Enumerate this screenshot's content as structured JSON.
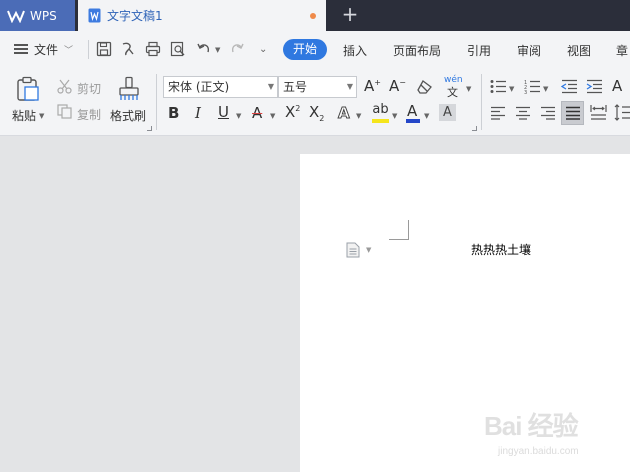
{
  "titlebar": {
    "app_tab": "WPS",
    "doc_tab": "文字文稿1",
    "new_tab_symbol": "+"
  },
  "menubar": {
    "file": "文件",
    "tabs": [
      "开始",
      "插入",
      "页面布局",
      "引用",
      "审阅",
      "视图",
      "章"
    ]
  },
  "ribbon": {
    "paste": "粘贴",
    "cut": "剪切",
    "copy": "复制",
    "format_painter": "格式刷",
    "font_name": "宋体 (正文)",
    "font_size": "五号"
  },
  "document": {
    "text": "热热热土壤"
  },
  "watermark": {
    "brand": "Bai 经验",
    "url": "jingyan.baidu.com"
  },
  "colors": {
    "titlebar_bg": "#2b2e3a",
    "wps_tab_bg": "#4b6cb7",
    "active_tab_pill": "#2f78e0",
    "unsaved_dot": "#ef8a4a",
    "highlight_yellow": "#f5e51c",
    "font_color_blue": "#2446c8"
  }
}
